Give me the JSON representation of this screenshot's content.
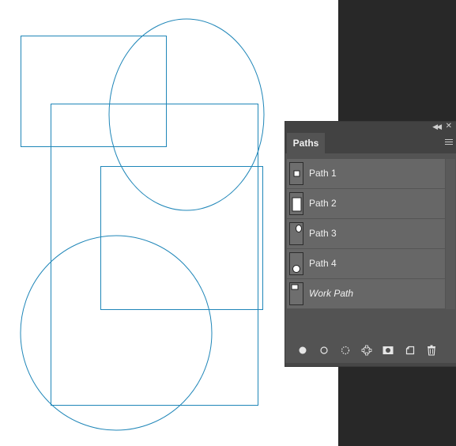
{
  "panel": {
    "tab_label": "Paths",
    "paths": [
      {
        "name": "Path 1",
        "thumb": "small-square"
      },
      {
        "name": "Path 2",
        "thumb": "tall-rectangle"
      },
      {
        "name": "Path 3",
        "thumb": "top-ellipse"
      },
      {
        "name": "Path 4",
        "thumb": "bottom-circle"
      },
      {
        "name": "Work Path",
        "thumb": "top-left-rectangle"
      }
    ],
    "icons": {
      "collapse": "double-chevron-left-icon",
      "close": "close-icon",
      "menu": "hamburger-menu-icon",
      "bottom": [
        "fill-path-icon",
        "stroke-path-icon",
        "load-as-selection-icon",
        "make-work-path-icon",
        "add-mask-icon",
        "new-path-icon",
        "delete-path-icon"
      ]
    }
  },
  "colors": {
    "path_stroke": "#1f86b8",
    "panel_bg": "#535353",
    "row_bg": "#676767",
    "dark_bg": "#282828"
  }
}
